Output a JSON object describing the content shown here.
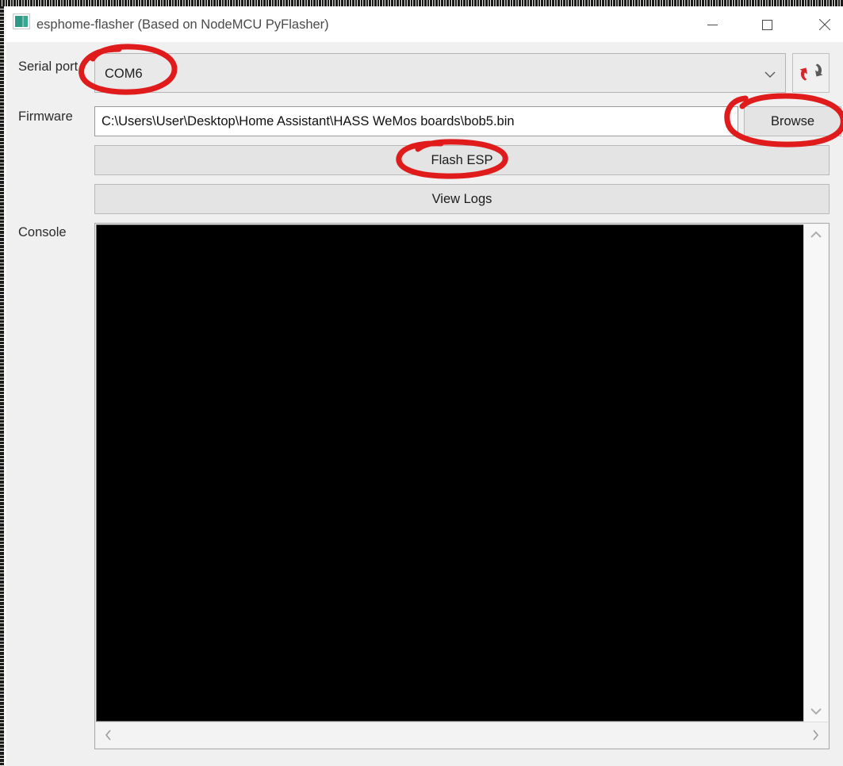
{
  "window": {
    "title": "esphome-flasher (Based on NodeMCU PyFlasher)",
    "app_icon": "application-icon",
    "controls": {
      "minimize": "minimize-icon",
      "maximize": "maximize-icon",
      "close": "close-icon"
    }
  },
  "form": {
    "serial_port": {
      "label": "Serial port",
      "value": "COM6",
      "dropdown_icon": "chevron-down-icon",
      "refresh_icon": "refresh-icon"
    },
    "firmware": {
      "label": "Firmware",
      "value": "C:\\Users\\User\\Desktop\\Home Assistant\\HASS WeMos boards\\bob5.bin",
      "placeholder": "",
      "browse_label": "Browse"
    },
    "flash_label": "Flash ESP",
    "logs_label": "View Logs"
  },
  "console": {
    "label": "Console",
    "content": "",
    "scroll_up_icon": "chevron-up-icon",
    "scroll_down_icon": "chevron-down-icon",
    "scroll_left_icon": "chevron-left-icon",
    "scroll_right_icon": "chevron-right-icon"
  },
  "annotations": {
    "color": "#e01b1b",
    "marks": [
      {
        "name": "circle-serial-port-value",
        "target": "COM6"
      },
      {
        "name": "circle-browse-button",
        "target": "Browse"
      },
      {
        "name": "circle-flash-esp-button",
        "target": "Flash ESP"
      }
    ]
  }
}
